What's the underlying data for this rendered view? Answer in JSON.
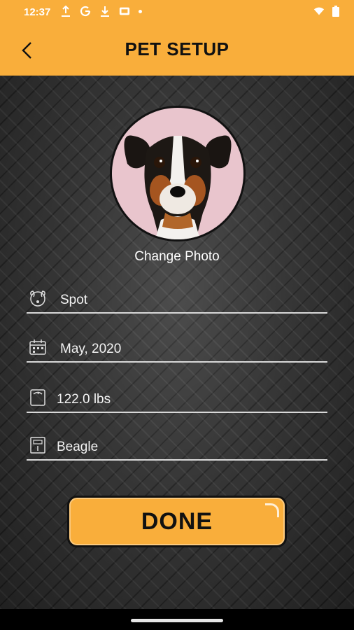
{
  "status_bar": {
    "time": "12:37",
    "icons": [
      "upload-icon",
      "google-icon",
      "download-icon",
      "cast-icon",
      "dot-icon",
      "wifi-icon",
      "battery-icon"
    ]
  },
  "header": {
    "title": "PET SETUP",
    "back_label": "<"
  },
  "profile": {
    "change_photo_label": "Change Photo"
  },
  "form": {
    "fields": [
      {
        "icon": "dog-icon",
        "value": "Spot"
      },
      {
        "icon": "calendar-icon",
        "value": "May, 2020"
      },
      {
        "icon": "scale-icon",
        "value": "122.0 lbs"
      },
      {
        "icon": "breed-icon",
        "value": "Beagle"
      }
    ]
  },
  "actions": {
    "done_label": "DONE"
  },
  "colors": {
    "accent": "#f9ae3b",
    "text_dark": "#111111",
    "text_light": "#f2f2f2"
  }
}
